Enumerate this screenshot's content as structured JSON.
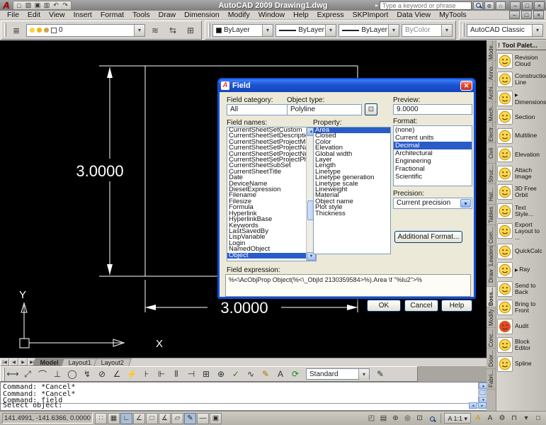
{
  "window": {
    "title": "AutoCAD 2009 Drawing1.dwg",
    "search_placeholder": "Type a keyword or phrase"
  },
  "icons": {
    "autocad_logo": "A",
    "quick_access": [
      "□",
      "▧",
      "▣",
      "▥",
      "↶",
      "↷"
    ],
    "search_arrow": "▸",
    "comm_center": "⊛",
    "favorites": "☆",
    "win_min": "–",
    "win_restore": "□",
    "win_close": "×",
    "doc_min": "–",
    "doc_restore": "□",
    "doc_close": "×",
    "select_object": "⊡",
    "palette_grip": "!",
    "tab_nav": [
      "|◀",
      "◀",
      "▶",
      "▶|"
    ],
    "layer_manager": "≣"
  },
  "menus": [
    "File",
    "Edit",
    "View",
    "Insert",
    "Format",
    "Tools",
    "Draw",
    "Dimension",
    "Modify",
    "Window",
    "Help",
    "Express",
    "SKPImport",
    "Data View",
    "MyTools"
  ],
  "layer_toolbar": {
    "layer_value": "0"
  },
  "properties_toolbar": {
    "color": "ByLayer",
    "linetype": "ByLayer",
    "lineweight": "ByLayer",
    "plot_style": "ByColor"
  },
  "workspace_toolbar": {
    "workspace": "AutoCAD Classic"
  },
  "canvas": {
    "dim_vertical": "3.0000",
    "dim_horizontal": "3.0000",
    "ucs_x": "X",
    "ucs_y": "Y"
  },
  "dialog": {
    "title": "Field",
    "category_label": "Field category:",
    "category_value": "All",
    "names_label": "Field names:",
    "names": [
      {
        "label": "CurrentSheetSetCustom"
      },
      {
        "label": "CurrentSheetSetDescription"
      },
      {
        "label": "CurrentSheetSetProjectMilestone"
      },
      {
        "label": "CurrentSheetSetProjectName"
      },
      {
        "label": "CurrentSheetSetProjectNumber"
      },
      {
        "label": "CurrentSheetSetProjectPhase"
      },
      {
        "label": "CurrentSheetSubSet"
      },
      {
        "label": "CurrentSheetTitle"
      },
      {
        "label": "Date"
      },
      {
        "label": "DeviceName"
      },
      {
        "label": "DieselExpression"
      },
      {
        "label": "Filename"
      },
      {
        "label": "Filesize"
      },
      {
        "label": "Formula"
      },
      {
        "label": "Hyperlink"
      },
      {
        "label": "HyperlinkBase"
      },
      {
        "label": "Keywords"
      },
      {
        "label": "LastSavedBy"
      },
      {
        "label": "LispVariable"
      },
      {
        "label": "Login"
      },
      {
        "label": "NamedObject"
      },
      {
        "label": "Object",
        "selected": true
      }
    ],
    "object_type_label": "Object type:",
    "object_type_value": "Polyline",
    "property_label": "Property:",
    "properties": [
      {
        "label": "Area",
        "selected": true
      },
      {
        "label": "Closed"
      },
      {
        "label": "Color"
      },
      {
        "label": "Elevation"
      },
      {
        "label": "Global width"
      },
      {
        "label": "Layer"
      },
      {
        "label": "Length"
      },
      {
        "label": "Linetype"
      },
      {
        "label": "Linetype generation"
      },
      {
        "label": "Linetype scale"
      },
      {
        "label": "Lineweight"
      },
      {
        "label": "Material"
      },
      {
        "label": "Object name"
      },
      {
        "label": "Plot style"
      },
      {
        "label": "Thickness"
      }
    ],
    "preview_label": "Preview:",
    "preview_value": "9.0000",
    "format_label": "Format:",
    "formats": [
      {
        "label": "(none)"
      },
      {
        "label": "Current units"
      },
      {
        "label": "Decimal",
        "selected": true
      },
      {
        "label": "Architectural"
      },
      {
        "label": "Engineering"
      },
      {
        "label": "Fractional"
      },
      {
        "label": "Scientific"
      }
    ],
    "precision_label": "Precision:",
    "precision_value": "Current precision",
    "additional_format": "Additional Format...",
    "expression_label": "Field expression:",
    "expression": "%<\\AcObjProp Object(%<\\_ObjId 2130359584>%).Area \\f \"%lu2\">%",
    "ok": "OK",
    "cancel": "Cancel",
    "help": "Help"
  },
  "palette": {
    "title": "Tool Palet...",
    "tabs": [
      {
        "label": "Mode..."
      },
      {
        "label": "Anno..."
      },
      {
        "label": "Archi..."
      },
      {
        "label": "Mech..."
      },
      {
        "label": "Electr..."
      },
      {
        "label": "Civil"
      },
      {
        "label": "Struc..."
      },
      {
        "label": "Hat..."
      },
      {
        "label": "Tables"
      },
      {
        "label": "Com..."
      },
      {
        "label": "Leaders"
      },
      {
        "label": "Draw"
      },
      {
        "label": "Boss...",
        "selected": true
      },
      {
        "label": "Modify"
      },
      {
        "label": "Conc..."
      },
      {
        "label": "Door..."
      },
      {
        "label": "Fabri..."
      }
    ],
    "items": [
      {
        "label": "Revision Cloud"
      },
      {
        "label": "Construction Line"
      },
      {
        "label": "Dimensions",
        "flyout": true
      },
      {
        "label": "Section"
      },
      {
        "label": "Multiline"
      },
      {
        "label": "Elevation"
      },
      {
        "label": "Attach Image"
      },
      {
        "label": "3D Free Orbit"
      },
      {
        "label": "Text Style..."
      },
      {
        "label": "Export Layout to ..."
      },
      {
        "label": "QuickCalc"
      },
      {
        "label": "Ray",
        "flyout": true
      },
      {
        "label": "Send to Back"
      },
      {
        "label": "Bring to Front"
      },
      {
        "label": "Audit",
        "face": "#e8452c"
      },
      {
        "label": "Block Editor"
      },
      {
        "label": "Spline"
      }
    ]
  },
  "model_tabs": [
    {
      "label": "Model",
      "selected": true
    },
    {
      "label": "Layout1"
    },
    {
      "label": "Layout2"
    }
  ],
  "dim_toolbar": {
    "style": "Standard",
    "icons": [
      {
        "g": "⟷"
      },
      {
        "g": "⤢"
      },
      {
        "g": "⌒"
      },
      {
        "g": "⊥"
      },
      {
        "g": "◯"
      },
      {
        "g": "↯"
      },
      {
        "g": "⊘"
      },
      {
        "g": "∠"
      },
      {
        "g": "⚡",
        "tint": "#c89600"
      },
      {
        "g": "⊦"
      },
      {
        "g": "⊩"
      },
      {
        "g": "⫴"
      },
      {
        "g": "⊣"
      },
      {
        "g": "⊞"
      },
      {
        "g": "⊕"
      },
      {
        "g": "✓",
        "tint": "#1a8a1a"
      },
      {
        "g": "∿"
      },
      {
        "g": "✎",
        "tint": "#a07800"
      },
      {
        "g": "A"
      },
      {
        "g": "⟳",
        "tint": "#1a8a1a"
      }
    ],
    "style_icon": "✎"
  },
  "command": {
    "lines": [
      "Command: *Cancel*",
      "Command: *Cancel*",
      "Command: field"
    ],
    "prompt": "Select object:"
  },
  "status": {
    "coords": "141.4991, -141.6366, 0.0000",
    "toggles": [
      {
        "g": "∷"
      },
      {
        "g": "▦"
      },
      {
        "g": "∟",
        "selected": true
      },
      {
        "g": "∠"
      },
      {
        "g": "□"
      },
      {
        "g": "∡"
      },
      {
        "g": "▱"
      },
      {
        "g": "✎",
        "selected": true
      },
      {
        "g": "—"
      },
      {
        "g": "▣"
      }
    ],
    "right_icons": [
      {
        "g": "◰"
      },
      {
        "g": "▤"
      },
      {
        "g": "⊕"
      },
      {
        "g": "◎"
      },
      {
        "g": "⊡"
      }
    ],
    "scale": "A 1:1 ▾",
    "right_icons2": [
      {
        "g": "A",
        "tint": "#c89600"
      },
      {
        "g": "A"
      },
      {
        "g": "⚙"
      },
      {
        "g": "⊓"
      },
      {
        "g": "▾"
      },
      {
        "g": "□"
      }
    ]
  }
}
